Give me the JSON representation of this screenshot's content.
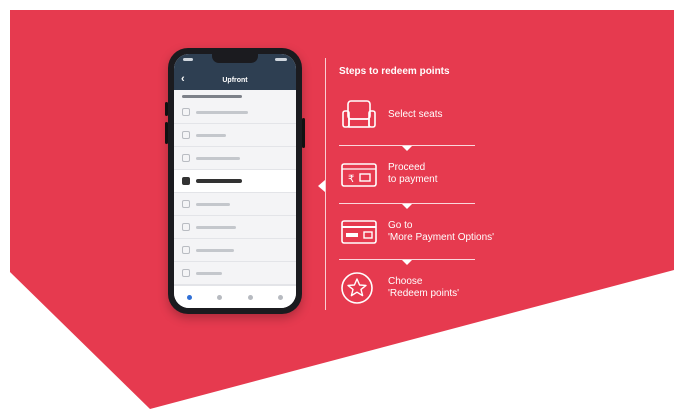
{
  "colors": {
    "banner": "#e63a4f",
    "phone_header": "#2e3f52",
    "text_light": "#ffffff"
  },
  "phone": {
    "title": "Upfront",
    "active_item_index": 4
  },
  "steps": {
    "title": "Steps to redeem points",
    "items": [
      {
        "icon": "seat-icon",
        "line1": "Select seats",
        "line2": ""
      },
      {
        "icon": "payment-ticket-icon",
        "line1": "Proceed",
        "line2": "to payment"
      },
      {
        "icon": "card-icon",
        "line1": "Go to",
        "line2": "'More Payment Options'"
      },
      {
        "icon": "star-badge-icon",
        "line1": "Choose",
        "line2": "'Redeem points'"
      }
    ]
  }
}
